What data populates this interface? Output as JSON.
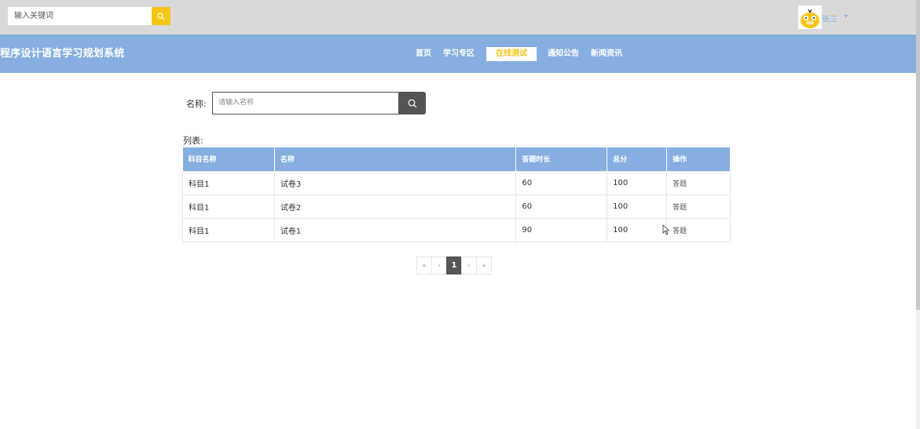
{
  "topbar": {
    "search_placeholder": "输入关键词",
    "user_name": "张三",
    "user_caret": "▾"
  },
  "nav": {
    "brand": "程序设计语言学习规划系统",
    "items": [
      {
        "label": "首页"
      },
      {
        "label": "学习专区"
      },
      {
        "label": "在线测试"
      },
      {
        "label": "通知公告"
      },
      {
        "label": "新闻资讯"
      }
    ],
    "active_index": 2
  },
  "filter": {
    "name_label": "名称:",
    "name_placeholder": "请输入名称"
  },
  "list": {
    "label": "列表:",
    "headers": [
      "科目名称",
      "名称",
      "答题时长",
      "总分",
      "操作"
    ],
    "rows": [
      {
        "subject": "科目1",
        "name": "试卷3",
        "duration": "60",
        "score": "100",
        "action": "答题"
      },
      {
        "subject": "科目1",
        "name": "试卷2",
        "duration": "60",
        "score": "100",
        "action": "答题"
      },
      {
        "subject": "科目1",
        "name": "试卷1",
        "duration": "90",
        "score": "100",
        "action": "答题"
      }
    ]
  },
  "pagination": {
    "first": "«",
    "prev": "‹",
    "current": "1",
    "next": "›",
    "last": "»"
  },
  "colors": {
    "nav_bg": "#86aee0",
    "accent": "#f5c518",
    "topbar_bg": "#d9d9d9"
  }
}
